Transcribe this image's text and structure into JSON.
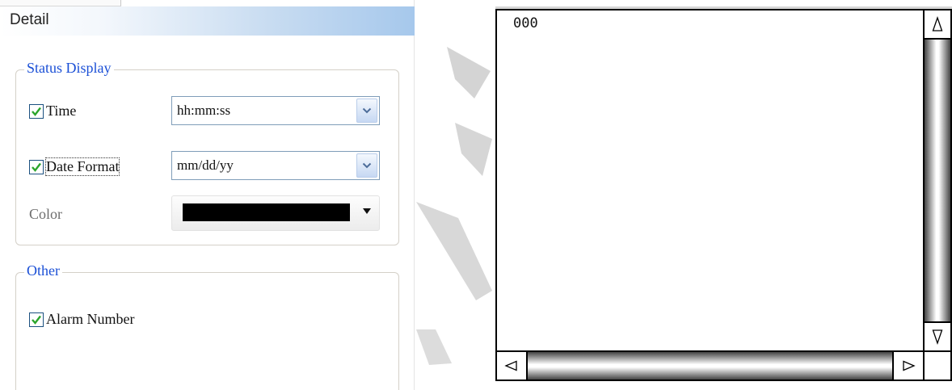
{
  "detail_panel": {
    "title": "Detail",
    "status_display": {
      "legend": "Status Display",
      "time": {
        "label": "Time",
        "checked": true,
        "format_value": "hh:mm:ss"
      },
      "date": {
        "label": "Date Format",
        "checked": true,
        "format_value": "mm/dd/yy"
      },
      "color": {
        "label": "Color",
        "value": "#000000"
      }
    },
    "other": {
      "legend": "Other",
      "alarm_number": {
        "label": "Alarm Number",
        "checked": true
      }
    }
  },
  "display_area": {
    "content_text": "000"
  },
  "icons": {
    "checkbox_check": "check-icon",
    "dropdown": "chevron-down-icon",
    "color_dropdown": "caret-down-icon",
    "scroll_up": "triangle-up-icon",
    "scroll_down": "triangle-down-icon",
    "scroll_left": "triangle-left-icon",
    "scroll_right": "triangle-right-icon"
  },
  "colors": {
    "legend_text": "#1a4fd6",
    "checkbox_border": "#1c5180",
    "check_mark": "#2ca52c",
    "header_gradient_end": "#a6c8ec"
  }
}
